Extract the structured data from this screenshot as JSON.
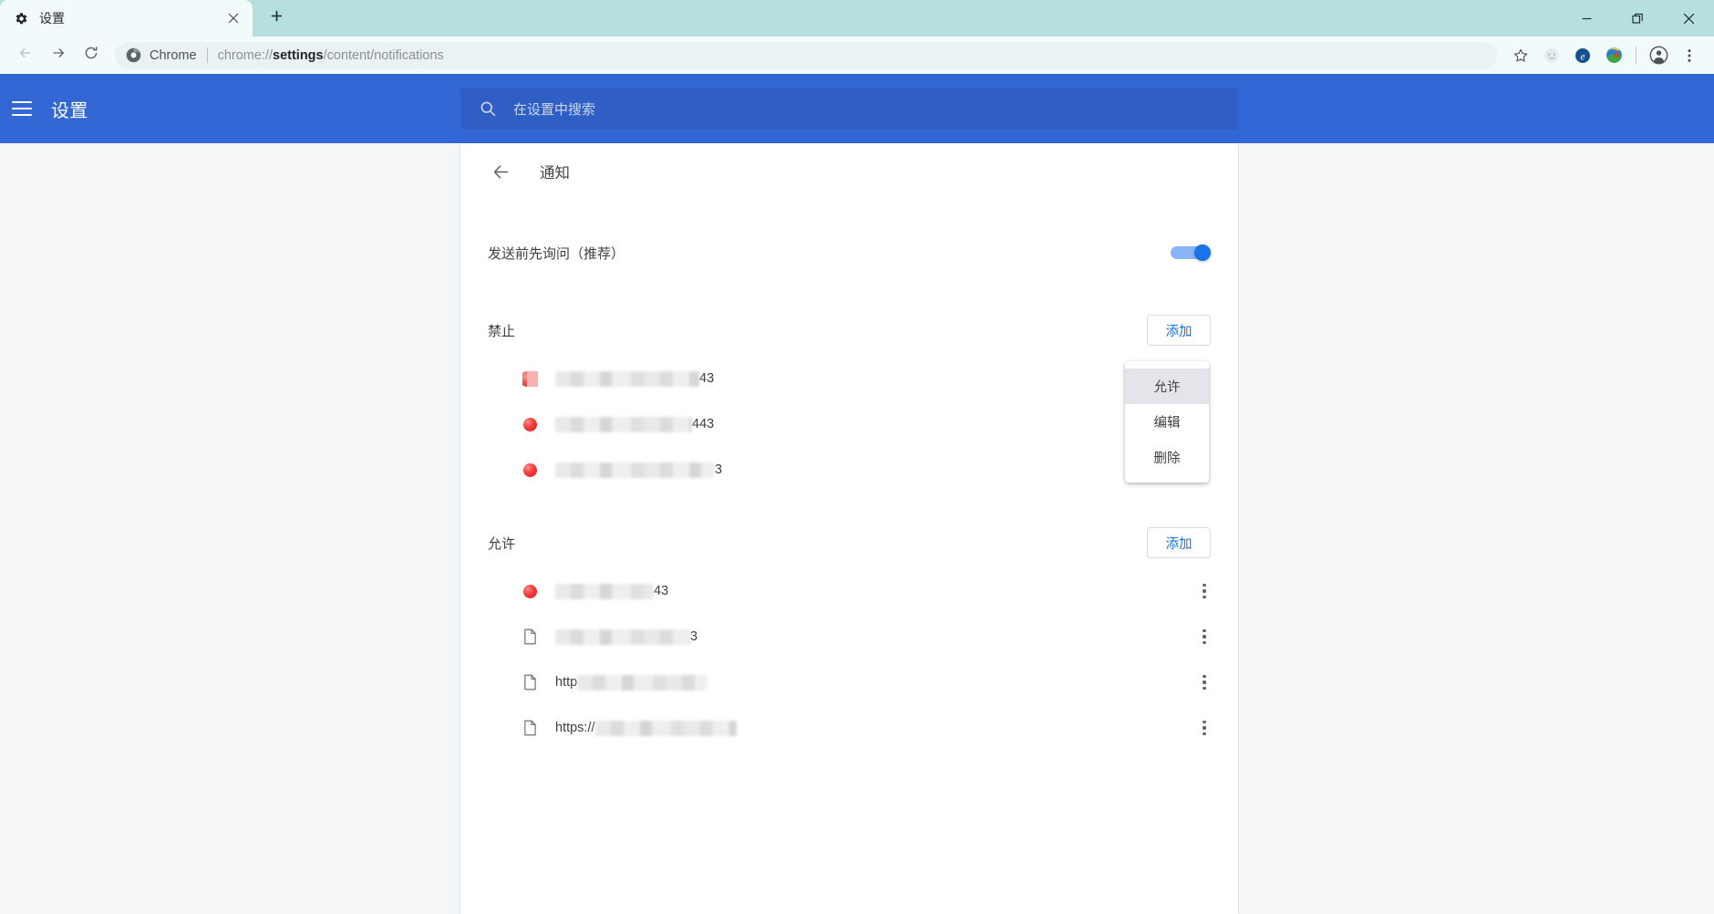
{
  "browser": {
    "tab": {
      "title": "设置",
      "favicon_icon": "gear-icon",
      "close_icon": "close-icon"
    },
    "new_tab_icon": "plus-icon",
    "window_controls": {
      "minimize_icon": "minimize-icon",
      "maximize_icon": "restore-icon",
      "close_icon": "close-icon"
    },
    "nav": {
      "back_icon": "arrow-left-icon",
      "forward_icon": "arrow-right-icon",
      "reload_icon": "reload-icon"
    },
    "omnibox": {
      "site_icon": "chrome-logo-icon",
      "site_label": "Chrome",
      "url_prefix": "chrome://",
      "url_highlight": "settings",
      "url_suffix": "/content/notifications"
    },
    "toolbar_icons": [
      {
        "name": "bookmark-star-icon",
        "glyph": "star"
      },
      {
        "name": "extension-gray-icon",
        "glyph": "circle"
      },
      {
        "name": "extension-blue-e-icon",
        "glyph": "e"
      },
      {
        "name": "download-manager-icon",
        "glyph": "globe"
      },
      {
        "name": "profile-avatar-icon",
        "glyph": "person"
      },
      {
        "name": "chrome-menu-icon",
        "glyph": "kebab"
      }
    ]
  },
  "settings_header": {
    "menu_icon": "hamburger-icon",
    "title": "设置",
    "search": {
      "icon": "search-icon",
      "placeholder": "在设置中搜索",
      "value": ""
    }
  },
  "page": {
    "back_icon": "arrow-left-icon",
    "title": "通知",
    "ask_before_sending": {
      "label": "发送前先询问（推荐）",
      "toggle_on": true
    },
    "sections": [
      {
        "id": "block",
        "title": "禁止",
        "add_label": "添加",
        "sites": [
          {
            "favicon": "red-ball-clipped-icon",
            "prefix": "",
            "redact_width": 158,
            "suffix": "43"
          },
          {
            "favicon": "red-ball-icon",
            "prefix": "",
            "redact_width": 150,
            "suffix": "443"
          },
          {
            "favicon": "red-ball-icon",
            "prefix": "",
            "redact_width": 175,
            "suffix": "3"
          }
        ]
      },
      {
        "id": "allow",
        "title": "允许",
        "add_label": "添加",
        "sites": [
          {
            "favicon": "red-ball-icon",
            "prefix": "",
            "redact_width": 108,
            "suffix": "43"
          },
          {
            "favicon": "document-icon",
            "prefix": "",
            "redact_width": 148,
            "suffix": "3"
          },
          {
            "favicon": "document-icon",
            "prefix": "http",
            "redact_width": 143,
            "suffix": ""
          },
          {
            "favicon": "document-icon",
            "prefix": "https://",
            "redact_width": 155,
            "suffix": ""
          }
        ]
      }
    ],
    "row_menu_icon": "kebab-menu-icon"
  },
  "context_menu": {
    "items": [
      {
        "label": "允许",
        "active": true
      },
      {
        "label": "编辑",
        "active": false
      },
      {
        "label": "删除",
        "active": false
      }
    ]
  },
  "colors": {
    "tabstrip": "#b6dfdf",
    "toolbar": "#f1fbfb",
    "settings_header": "#3367d6",
    "accent_blue": "#1a73e8",
    "page_bg": "#f5f6f7"
  }
}
